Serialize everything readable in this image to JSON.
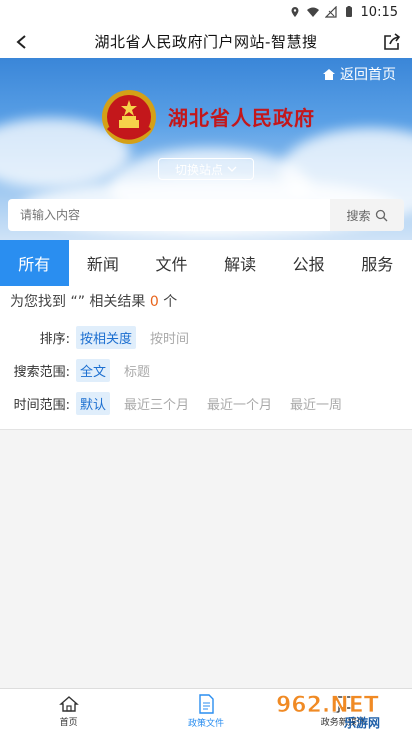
{
  "status": {
    "time": "10:15"
  },
  "header": {
    "title": "湖北省人民政府门户网站-智慧搜"
  },
  "banner": {
    "home_link": "返回首页",
    "gov_name": "湖北省人民政府",
    "switch_site": "切换站点"
  },
  "search": {
    "placeholder": "请输入内容",
    "button": "搜索"
  },
  "tabs": [
    {
      "label": "所有",
      "active": true
    },
    {
      "label": "新闻"
    },
    {
      "label": "文件"
    },
    {
      "label": "解读"
    },
    {
      "label": "公报"
    },
    {
      "label": "服务"
    }
  ],
  "results": {
    "prefix": "为您找到 “” 相关结果",
    "count": "0",
    "suffix": "个"
  },
  "filters": {
    "sort": {
      "label": "排序:",
      "options": [
        "按相关度",
        "按时间"
      ]
    },
    "scope": {
      "label": "搜索范围:",
      "options": [
        "全文",
        "标题"
      ]
    },
    "time": {
      "label": "时间范围:",
      "options": [
        "默认",
        "最近三个月",
        "最近一个月",
        "最近一周"
      ]
    }
  },
  "bottom_nav": [
    {
      "label": "首页",
      "icon": "home-icon"
    },
    {
      "label": "政策文件",
      "icon": "document-icon",
      "active": true
    },
    {
      "label": "政务新媒体",
      "icon": "media-icon"
    }
  ],
  "watermark": {
    "text": "962.NET",
    "sub": "乐游网"
  },
  "colors": {
    "accent": "#2a8ef0",
    "gov_red": "#c3171b",
    "count_orange": "#e8641b"
  }
}
